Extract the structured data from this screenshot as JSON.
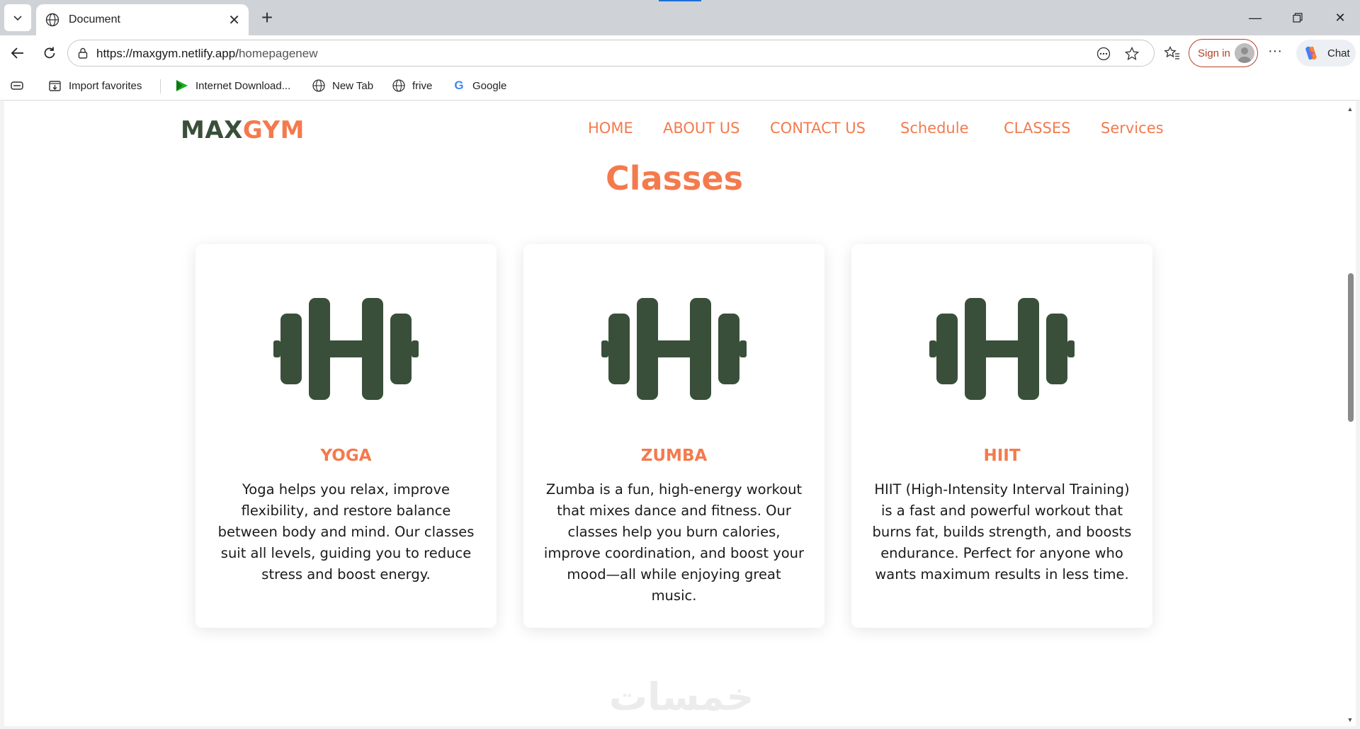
{
  "browser": {
    "tab_title": "Document",
    "url_host": "https://maxgym.netlify.app/",
    "url_path": "homepagenew",
    "signin_label": "Sign in",
    "chat_label": "Chat",
    "favorites": [
      {
        "label": "Import favorites",
        "icon": "import-favorites-icon"
      },
      {
        "label": "Internet Download...",
        "icon": "idm-icon"
      },
      {
        "label": "New Tab",
        "icon": "globe-icon"
      },
      {
        "label": "frive",
        "icon": "globe-icon"
      },
      {
        "label": "Google",
        "icon": "google-icon"
      }
    ]
  },
  "site": {
    "logo_part1": "MAX",
    "logo_part2": "GYM",
    "nav": [
      "HOME",
      "ABOUT US",
      "CONTACT US",
      "Schedule",
      "CLASSES",
      "Services"
    ],
    "section_title": "Classes",
    "cards": [
      {
        "title": "YOGA",
        "text": "Yoga helps you relax, improve flexibility, and restore balance between body and mind. Our classes suit all levels, guiding you to reduce stress and boost energy.",
        "icon": "dumbbell-icon"
      },
      {
        "title": "ZUMBA",
        "text": "Zumba is a fun, high-energy workout that mixes dance and fitness. Our classes help you burn calories, improve coordination, and boost your mood—all while enjoying great music.",
        "icon": "dumbbell-icon"
      },
      {
        "title": "HIIT",
        "text": "HIIT (High-Intensity Interval Training) is a fast and powerful workout that burns fat, builds strength, and boosts endurance. Perfect for anyone who wants maximum results in less time.",
        "icon": "dumbbell-icon"
      }
    ],
    "watermark": "خمسات"
  },
  "colors": {
    "accent": "#f47a4d",
    "dark_green": "#3a4f3a",
    "chrome_bg": "#cfd3d8"
  }
}
